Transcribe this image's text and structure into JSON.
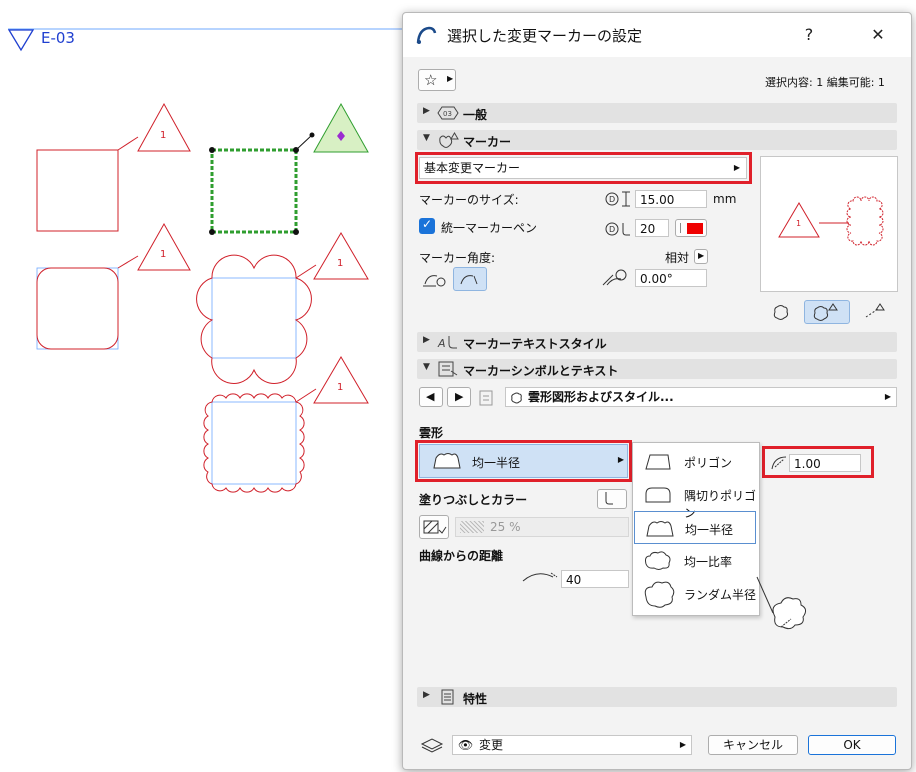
{
  "canvas": {
    "story_marker": "E-03",
    "marker_tag_text": "1"
  },
  "dialog": {
    "title": "選択した変更マーカーの設定",
    "help": "?",
    "close": "✕",
    "selection_info": "選択内容: 1 編集可能: 1",
    "sections": {
      "general": "一般",
      "marker": "マーカー",
      "marker_text_style": "マーカーテキストスタイル",
      "marker_symbol_text": "マーカーシンボルとテキスト",
      "properties": "特性"
    },
    "general_icon_text": "03",
    "marker": {
      "type_value": "基本変更マーカー",
      "size_label": "マーカーのサイズ:",
      "size_value": "15.00",
      "size_unit": "mm",
      "uniform_pen_label": "統一マーカーペン",
      "pen_value": "20",
      "angle_label": "マーカー角度:",
      "relative_label": "相対",
      "angle_value": "0.00°",
      "preview_tag": "1"
    },
    "symbol_nav": {
      "value": "雲形図形およびスタイル..."
    },
    "cloud": {
      "heading": "雲形",
      "style_value": "均一半径",
      "radius_value": "1.00",
      "fill_label": "塗りつぶしとカラー",
      "fill_percent": "25 %",
      "distance_label": "曲線からの距離",
      "distance_value": "40",
      "dropdown_options": [
        "ポリゴン",
        "隅切りポリゴン",
        "均一半径",
        "均一比率",
        "ランダム半径"
      ],
      "dropdown_selected": "均一半径"
    },
    "footer": {
      "layer_value": "変更",
      "cancel": "キャンセル",
      "ok": "OK"
    }
  },
  "colors": {
    "accent_red": "#e0202a",
    "checkbox_blue": "#1a73d9",
    "marker_red": "#d0202a",
    "selection_green": "#2f9e2f",
    "link_blue": "#1f3fd0"
  }
}
